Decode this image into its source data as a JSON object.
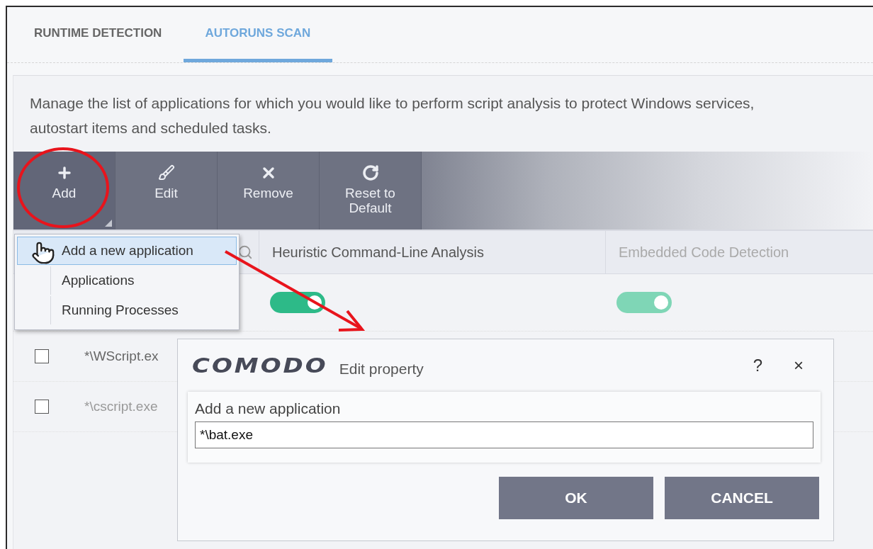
{
  "tabs": [
    {
      "label": "RUNTIME DETECTION",
      "selected": false
    },
    {
      "label": "AUTORUNS SCAN",
      "selected": true
    }
  ],
  "description": "Manage the list of applications for which you would like to perform script analysis to protect Windows services, autostart items and scheduled tasks.",
  "toolbar": [
    {
      "kind": "add",
      "label": "Add",
      "active": true,
      "dropdown": true
    },
    {
      "kind": "edit",
      "label": "Edit",
      "active": false,
      "dropdown": false
    },
    {
      "kind": "remove",
      "label": "Remove",
      "active": false,
      "dropdown": false
    },
    {
      "kind": "reset",
      "label": "Reset to Default",
      "active": false,
      "dropdown": false
    }
  ],
  "add_menu": [
    {
      "label": "Add a new application",
      "selected": true
    },
    {
      "label": "Applications",
      "selected": false
    },
    {
      "label": "Running Processes",
      "selected": false
    }
  ],
  "table": {
    "columns": [
      "Heuristic Command-Line Analysis",
      "Embedded Code Detection"
    ],
    "toggles": [
      {
        "on": true,
        "disabled": false
      },
      {
        "on": true,
        "disabled": true
      }
    ],
    "rows": [
      {
        "name": "*\\WScript.ex",
        "checked": false,
        "disabled": false
      },
      {
        "name": "*\\cscript.exe",
        "checked": false,
        "disabled": true
      }
    ]
  },
  "dialog": {
    "logo": "COMODO",
    "title": "Edit property",
    "help": "?",
    "close": "×",
    "field_label": "Add a new application",
    "field_value": "*\\bat.exe",
    "buttons": [
      "OK",
      "CANCEL"
    ]
  }
}
